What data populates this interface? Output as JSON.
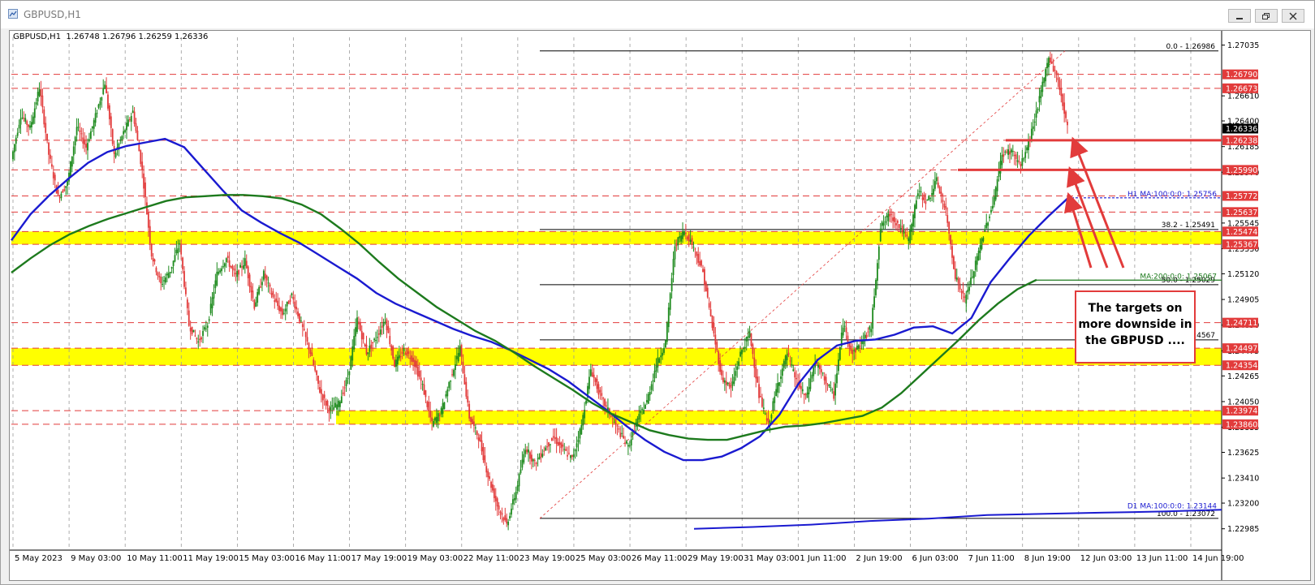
{
  "window": {
    "title": "GBPUSD,H1"
  },
  "header": {
    "info": "GBPUSD,H1  1.26748 1.26796 1.26259 1.26336"
  },
  "annotation": {
    "text": "The targets on more downside in the GBPUSD ...."
  },
  "chart_data": {
    "type": "candlestick",
    "symbol": "GBPUSD",
    "timeframe": "H1",
    "ohlc_last": {
      "open": 1.26748,
      "high": 1.26796,
      "low": 1.26259,
      "close": 1.26336
    },
    "ylim": [
      1.2282,
      1.271
    ],
    "price_ticks": [
      1.27035,
      1.2661,
      1.264,
      1.26185,
      1.2597,
      1.25545,
      1.2533,
      1.2512,
      1.24905,
      1.2469,
      1.24475,
      1.24265,
      1.2405,
      1.23835,
      1.23625,
      1.2341,
      1.232,
      1.22985
    ],
    "price_tick_labels": [
      "1.27035",
      "1.26610",
      "1.26400",
      "1.26185",
      "1.25970",
      "1.25545",
      "1.25330",
      "1.25120",
      "1.24905",
      "1.24690",
      "1.24475",
      "1.24265",
      "1.24050",
      "1.23835",
      "1.23625",
      "1.23410",
      "1.23200",
      "1.22985"
    ],
    "time_labels": [
      "5 May 2023",
      "9 May 03:00",
      "10 May 11:00",
      "11 May 19:00",
      "15 May 03:00",
      "16 May 11:00",
      "17 May 19:00",
      "19 May 03:00",
      "22 May 11:00",
      "23 May 19:00",
      "25 May 03:00",
      "26 May 11:00",
      "29 May 19:00",
      "31 May 03:00",
      "1 Jun 11:00",
      "2 Jun 19:00",
      "6 Jun 03:00",
      "7 Jun 11:00",
      "8 Jun 19:00",
      "12 Jun 03:00",
      "13 Jun 11:00",
      "14 Jun 19:00"
    ],
    "price_series": [
      1.2608,
      1.2645,
      1.2634,
      1.2668,
      1.2612,
      1.2576,
      1.2588,
      1.2635,
      1.2618,
      1.2644,
      1.2672,
      1.2611,
      1.263,
      1.2648,
      1.2598,
      1.2528,
      1.2503,
      1.2515,
      1.2538,
      1.2469,
      1.2455,
      1.247,
      1.2512,
      1.2525,
      1.251,
      1.2523,
      1.2485,
      1.2512,
      1.2492,
      1.2478,
      1.2494,
      1.247,
      1.2446,
      1.2414,
      1.2398,
      1.2403,
      1.2425,
      1.2474,
      1.2446,
      1.2458,
      1.2474,
      1.2436,
      1.2448,
      1.244,
      1.2418,
      1.2386,
      1.2397,
      1.2425,
      1.245,
      1.2392,
      1.2375,
      1.2343,
      1.2318,
      1.2302,
      1.233,
      1.2367,
      1.2353,
      1.2365,
      1.2375,
      1.2365,
      1.2357,
      1.2385,
      1.2432,
      1.241,
      1.2395,
      1.238,
      1.2367,
      1.239,
      1.2405,
      1.2436,
      1.2455,
      1.2536,
      1.2548,
      1.2535,
      1.2513,
      1.2468,
      1.2425,
      1.2416,
      1.2445,
      1.2462,
      1.241,
      1.2385,
      1.242,
      1.2445,
      1.2422,
      1.2408,
      1.2438,
      1.2424,
      1.241,
      1.247,
      1.2445,
      1.2455,
      1.2467,
      1.2551,
      1.2562,
      1.2552,
      1.254,
      1.2581,
      1.2572,
      1.259,
      1.2563,
      1.251,
      1.249,
      1.2515,
      1.2545,
      1.257,
      1.2612,
      1.2615,
      1.2602,
      1.2626,
      1.2658,
      1.2694,
      1.2674,
      1.2634
    ],
    "moving_averages": [
      {
        "label": "H1 MA:100:0:0: 1.25756",
        "color": "#1a1ad0",
        "values": [
          1.254,
          1.2562,
          1.2578,
          1.2592,
          1.2605,
          1.2614,
          1.2619,
          1.2622,
          1.2625,
          1.2618,
          1.26,
          1.2582,
          1.2565,
          1.2555,
          1.2546,
          1.2538,
          1.2528,
          1.2518,
          1.2508,
          1.2496,
          1.2487,
          1.248,
          1.2473,
          1.2466,
          1.246,
          1.2455,
          1.2448,
          1.244,
          1.2432,
          1.2422,
          1.241,
          1.2398,
          1.2385,
          1.2373,
          1.2363,
          1.2356,
          1.2356,
          1.2359,
          1.2366,
          1.2376,
          1.2394,
          1.242,
          1.244,
          1.2452,
          1.2456,
          1.2457,
          1.2461,
          1.2467,
          1.2468,
          1.2462,
          1.2475,
          1.2505,
          1.2525,
          1.2544,
          1.256,
          1.2575
        ]
      },
      {
        "label": "MA:200:0:0: 1.25067",
        "color": "#1d7a1d",
        "values": [
          1.2513,
          1.2525,
          1.2536,
          1.2545,
          1.2552,
          1.2558,
          1.2563,
          1.2568,
          1.2573,
          1.2576,
          1.2577,
          1.2578,
          1.2578,
          1.2577,
          1.2575,
          1.257,
          1.2562,
          1.255,
          1.2537,
          1.2522,
          1.2508,
          1.2496,
          1.2484,
          1.2474,
          1.2464,
          1.2456,
          1.2446,
          1.2435,
          1.2425,
          1.2415,
          1.2404,
          1.2395,
          1.2388,
          1.2381,
          1.2377,
          1.2374,
          1.2373,
          1.2373,
          1.2377,
          1.2381,
          1.2384,
          1.2385,
          1.2387,
          1.239,
          1.2393,
          1.24,
          1.2412,
          1.2427,
          1.2442,
          1.2457,
          1.2473,
          1.2487,
          1.2499,
          1.2507
        ]
      },
      {
        "label": "D1 MA:100:0:0: 1.23144",
        "color": "#1a1ad0",
        "values": [
          1.22985,
          1.23,
          1.2302,
          1.2305,
          1.2307,
          1.231,
          1.2311,
          1.2312,
          1.2313,
          1.23144
        ]
      }
    ],
    "fibonacci": [
      {
        "label": "0.0 - 1.26986",
        "level": 1.26986
      },
      {
        "label": "38.2 - 1.25491",
        "level": 1.25491
      },
      {
        "label": "50.0 - 1.25029",
        "level": 1.25029
      },
      {
        "label": "61.8 - 1.24567",
        "level": 1.24567
      },
      {
        "label": "100.0 - 1.23072",
        "level": 1.23072
      }
    ],
    "hlines": [
      {
        "label": "1.26790",
        "level": 1.2679
      },
      {
        "label": "1.26673",
        "level": 1.26673
      },
      {
        "label": "1.26238",
        "level": 1.26238
      },
      {
        "label": "1.25990",
        "level": 1.2599
      },
      {
        "label": "1.25772",
        "level": 1.25772
      },
      {
        "label": "1.25637",
        "level": 1.25637
      },
      {
        "label": "1.25474",
        "level": 1.25474
      },
      {
        "label": "1.25367",
        "level": 1.25367
      },
      {
        "label": "1.24711",
        "level": 1.24711
      },
      {
        "label": "1.24497",
        "level": 1.24497
      },
      {
        "label": "1.24354",
        "level": 1.24354
      },
      {
        "label": "1.23974",
        "level": 1.23974
      },
      {
        "label": "1.23860",
        "level": 1.2386
      }
    ],
    "zones": [
      {
        "from": 1.25367,
        "to": 1.25474
      },
      {
        "from": 1.24354,
        "to": 1.24497
      },
      {
        "from": 1.2386,
        "to": 1.23974
      }
    ],
    "current_price": {
      "label": "1.26336",
      "level": 1.26336
    },
    "ma_level_labels": [
      "H1 MA:100:0:0: 1.25756",
      "MA:200:0:0: 1.25067",
      "D1 MA:100:0:0: 1.23144"
    ],
    "target_levels": [
      1.26238,
      1.2599,
      1.25772
    ]
  }
}
